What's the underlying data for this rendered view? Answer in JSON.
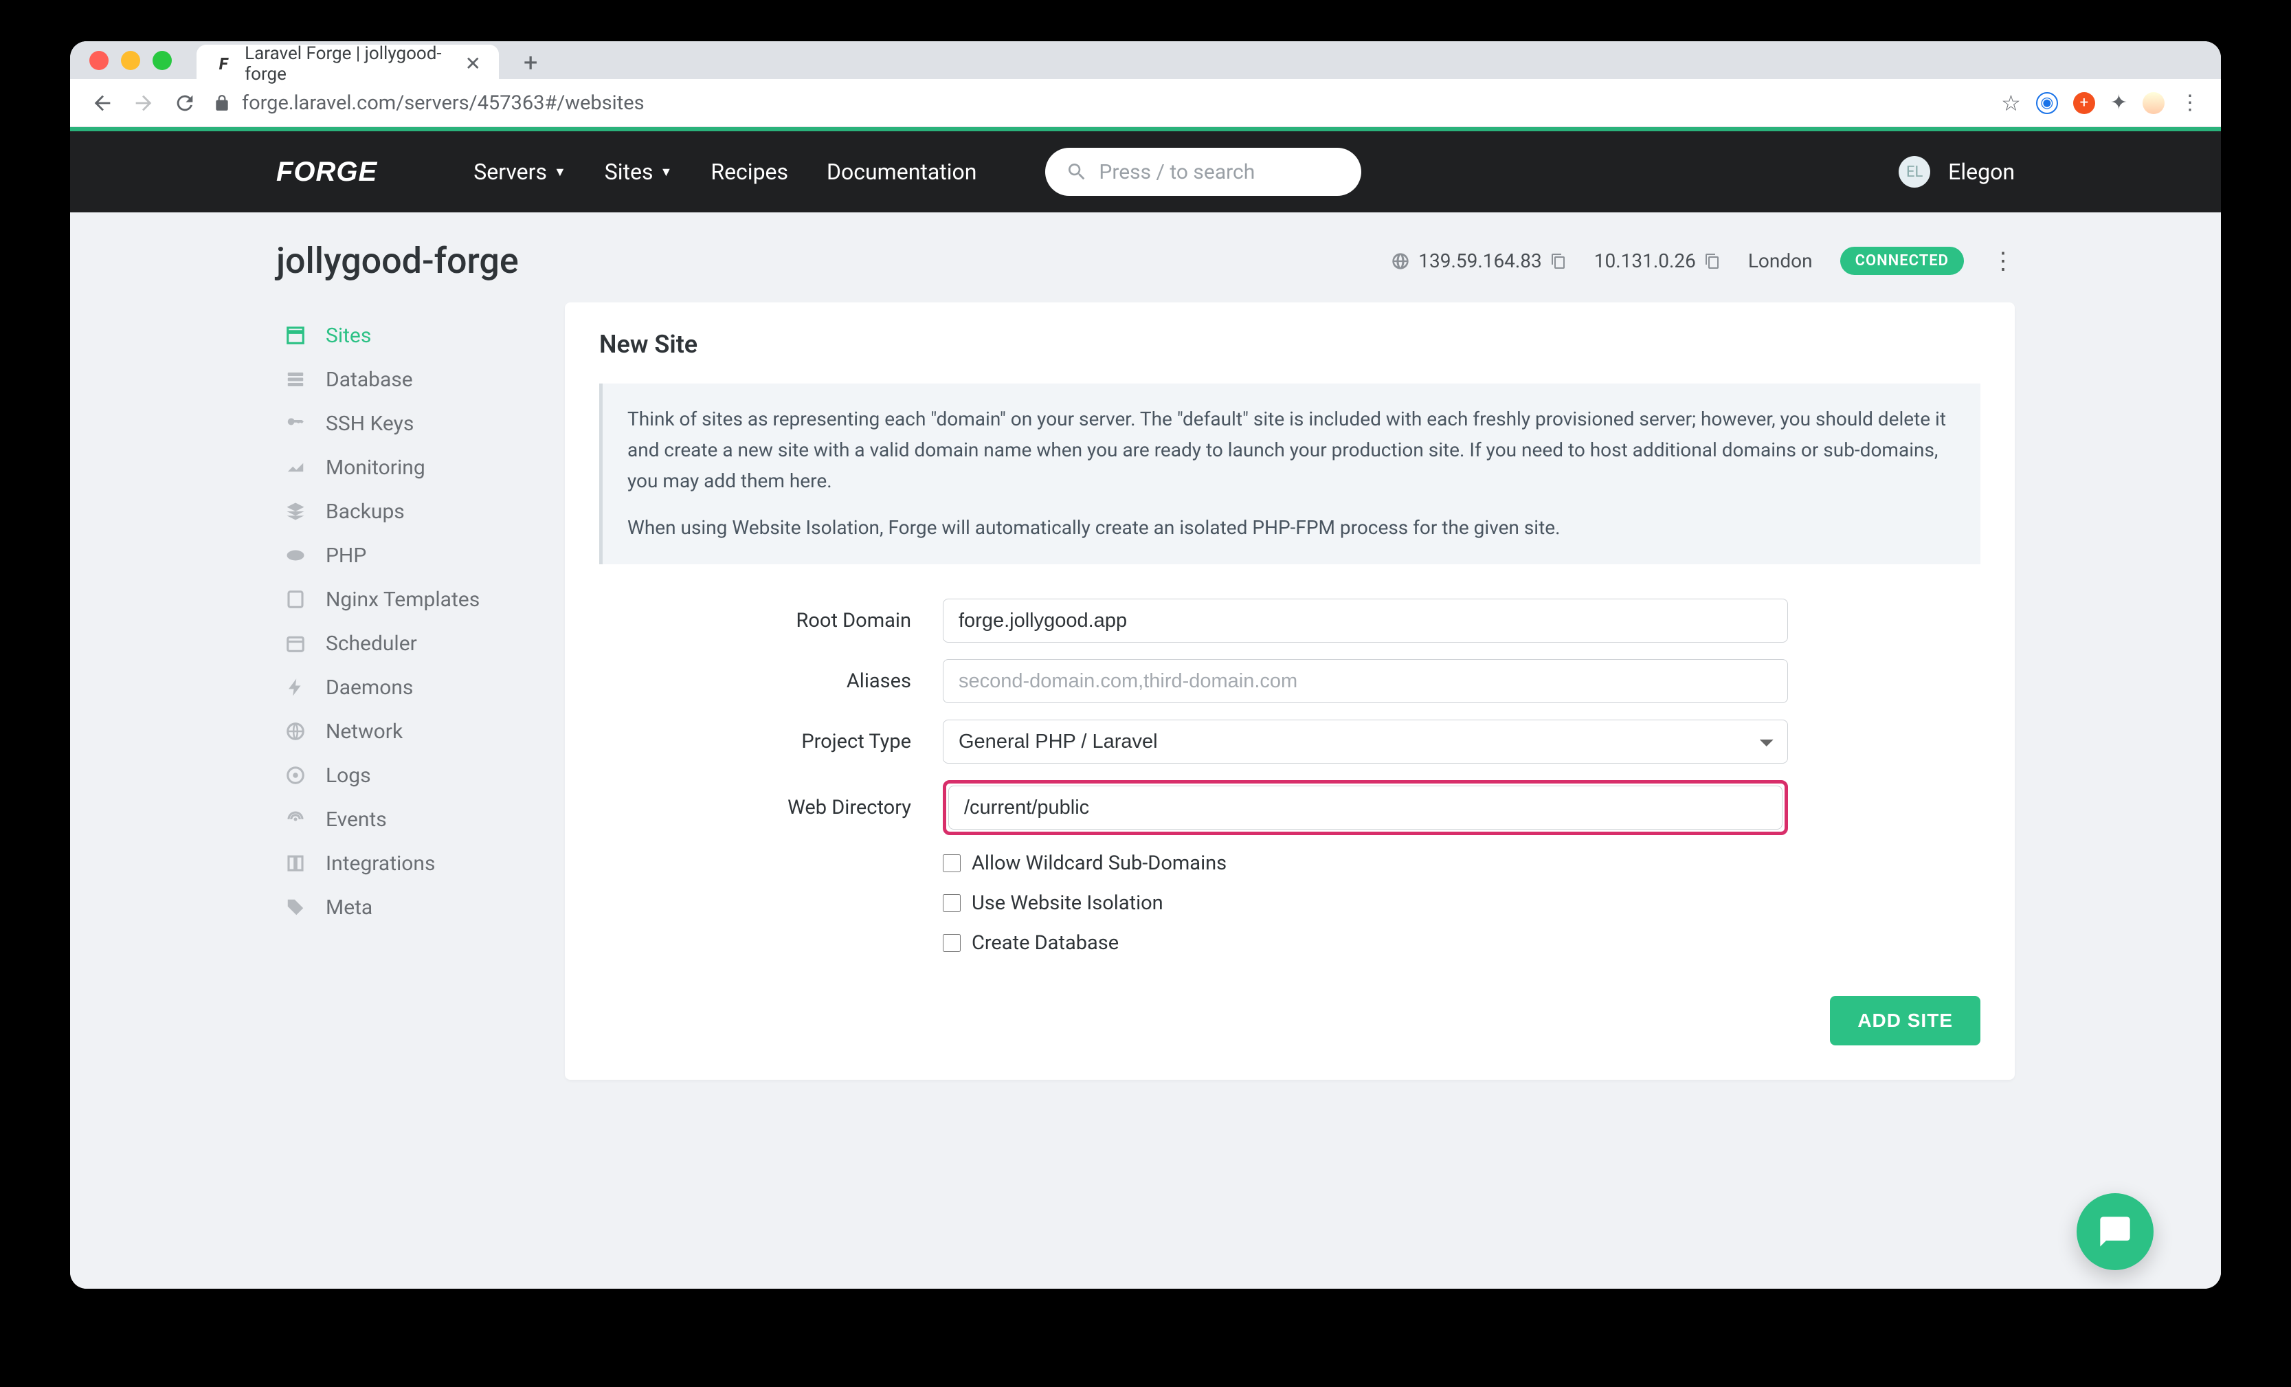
{
  "browser": {
    "tab_title": "Laravel Forge | jollygood-forge",
    "url": "forge.laravel.com/servers/457363#/websites"
  },
  "nav": {
    "logo": "FORGE",
    "items": [
      {
        "label": "Servers",
        "has_caret": true
      },
      {
        "label": "Sites",
        "has_caret": true
      },
      {
        "label": "Recipes",
        "has_caret": false
      },
      {
        "label": "Documentation",
        "has_caret": false
      }
    ],
    "search_placeholder": "Press / to search",
    "avatar_initials": "EL",
    "username": "Elegon"
  },
  "server": {
    "name": "jollygood-forge",
    "public_ip": "139.59.164.83",
    "private_ip": "10.131.0.26",
    "region": "London",
    "status": "CONNECTED"
  },
  "sidebar": {
    "items": [
      {
        "label": "Sites",
        "icon": "layout"
      },
      {
        "label": "Database",
        "icon": "database"
      },
      {
        "label": "SSH Keys",
        "icon": "key"
      },
      {
        "label": "Monitoring",
        "icon": "chart"
      },
      {
        "label": "Backups",
        "icon": "layers"
      },
      {
        "label": "PHP",
        "icon": "php"
      },
      {
        "label": "Nginx Templates",
        "icon": "template"
      },
      {
        "label": "Scheduler",
        "icon": "calendar"
      },
      {
        "label": "Daemons",
        "icon": "bolt"
      },
      {
        "label": "Network",
        "icon": "globe"
      },
      {
        "label": "Logs",
        "icon": "logs"
      },
      {
        "label": "Events",
        "icon": "broadcast"
      },
      {
        "label": "Integrations",
        "icon": "book"
      },
      {
        "label": "Meta",
        "icon": "tag"
      }
    ]
  },
  "card": {
    "title": "New Site",
    "info1": "Think of sites as representing each \"domain\" on your server. The \"default\" site is included with each freshly provisioned server; however, you should delete it and create a new site with a valid domain name when you are ready to launch your production site. If you need to host additional domains or sub-domains, you may add them here.",
    "info2": "When using Website Isolation, Forge will automatically create an isolated PHP-FPM process for the given site.",
    "fields": {
      "root_domain": {
        "label": "Root Domain",
        "value": "forge.jollygood.app"
      },
      "aliases": {
        "label": "Aliases",
        "placeholder": "second-domain.com,third-domain.com"
      },
      "project_type": {
        "label": "Project Type",
        "value": "General PHP / Laravel"
      },
      "web_directory": {
        "label": "Web Directory",
        "value": "/current/public"
      }
    },
    "checkboxes": {
      "wildcard": "Allow Wildcard Sub-Domains",
      "isolation": "Use Website Isolation",
      "create_db": "Create Database"
    },
    "submit": "ADD SITE"
  }
}
